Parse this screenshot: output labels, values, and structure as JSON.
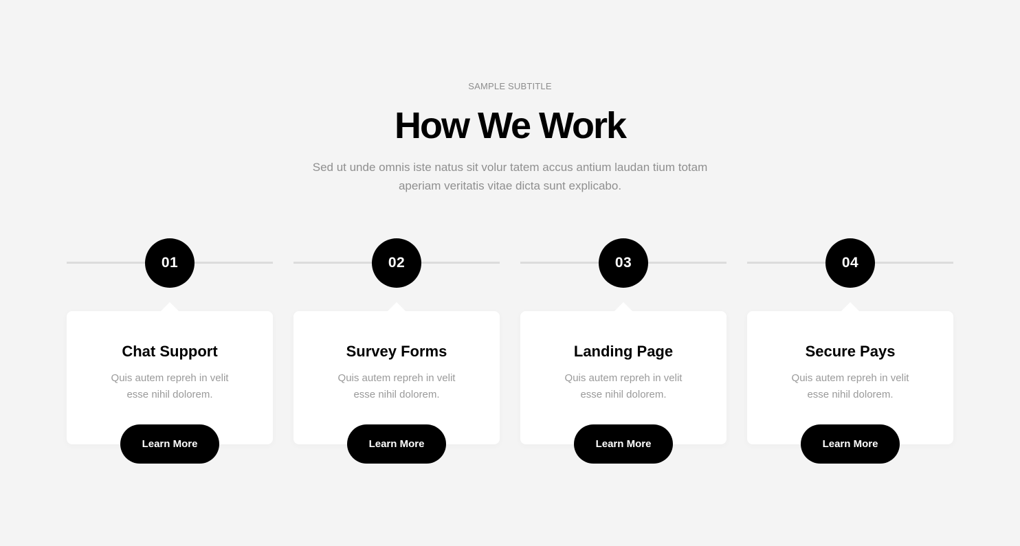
{
  "section": {
    "subtitle": "SAMPLE SUBTITLE",
    "title": "How We Work",
    "description": "Sed ut unde omnis iste natus sit volur tatem accus antium laudan tium totam aperiam veritatis vitae dicta sunt explicabo."
  },
  "steps": [
    {
      "number": "01",
      "title": "Chat Support",
      "text": "Quis autem repreh in velit esse nihil dolorem.",
      "button": "Learn More"
    },
    {
      "number": "02",
      "title": "Survey Forms",
      "text": "Quis autem repreh in velit esse nihil dolorem.",
      "button": "Learn More"
    },
    {
      "number": "03",
      "title": "Landing Page",
      "text": "Quis autem repreh in velit esse nihil dolorem.",
      "button": "Learn More"
    },
    {
      "number": "04",
      "title": "Secure Pays",
      "text": "Quis autem repreh in velit esse nihil dolorem.",
      "button": "Learn More"
    }
  ],
  "colors": {
    "background": "#f4f4f4",
    "accent": "#000000",
    "card": "#ffffff",
    "muted_text": "#8f8f8f"
  }
}
